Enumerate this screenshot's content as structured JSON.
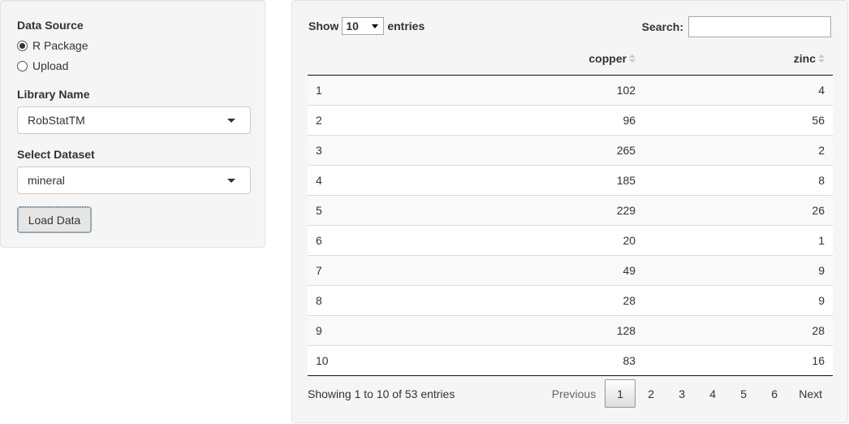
{
  "sidebar": {
    "data_source_label": "Data Source",
    "options": [
      {
        "label": "R Package",
        "checked": true
      },
      {
        "label": "Upload",
        "checked": false
      }
    ],
    "library_label": "Library Name",
    "library_value": "RobStatTM",
    "dataset_label": "Select Dataset",
    "dataset_value": "mineral",
    "load_button": "Load Data"
  },
  "table": {
    "show_label": "Show",
    "length_value": "10",
    "entries_label": "entries",
    "search_label": "Search:",
    "search_value": "",
    "columns": [
      "",
      "copper",
      "zinc"
    ],
    "rows": [
      [
        "1",
        "102",
        "4"
      ],
      [
        "2",
        "96",
        "56"
      ],
      [
        "3",
        "265",
        "2"
      ],
      [
        "4",
        "185",
        "8"
      ],
      [
        "5",
        "229",
        "26"
      ],
      [
        "6",
        "20",
        "1"
      ],
      [
        "7",
        "49",
        "9"
      ],
      [
        "8",
        "28",
        "9"
      ],
      [
        "9",
        "128",
        "28"
      ],
      [
        "10",
        "83",
        "16"
      ]
    ],
    "info": "Showing 1 to 10 of 53 entries",
    "pagination": {
      "previous": "Previous",
      "pages": [
        "1",
        "2",
        "3",
        "4",
        "5",
        "6"
      ],
      "current": "1",
      "next": "Next"
    }
  },
  "colors": {
    "panel_bg": "#f5f5f5",
    "odd_row": "#f9f9f9",
    "text": "#333333"
  }
}
